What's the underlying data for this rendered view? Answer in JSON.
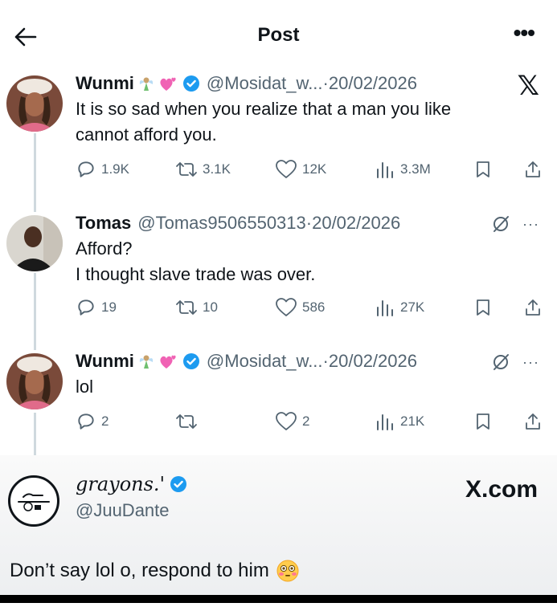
{
  "topbar": {
    "title": "Post"
  },
  "tweets": [
    {
      "name": "Wunmi",
      "emojis": [
        "fairy",
        "two-hearts"
      ],
      "verified": true,
      "handle": "@Mosidat_w...",
      "separator": "·",
      "date": "20/02/2026",
      "text_lines": [
        "It is so sad when you realize that a man you like",
        "cannot afford you."
      ],
      "replies": "1.9K",
      "reposts": "3.1K",
      "likes": "12K",
      "views": "3.3M"
    },
    {
      "name": "Tomas",
      "verified": false,
      "handle": "@Tomas9506550313",
      "separator": "·",
      "date": "20/02/2026",
      "text_lines": [
        "Afford?",
        "I thought slave trade was over."
      ],
      "replies": "19",
      "reposts": "10",
      "likes": "586",
      "views": "27K"
    },
    {
      "name": "Wunmi",
      "emojis": [
        "fairy",
        "two-hearts"
      ],
      "verified": true,
      "handle": "@Mosidat_w...",
      "separator": "·",
      "date": "20/02/2026",
      "text_lines": [
        "lol"
      ],
      "replies": "2",
      "reposts": "",
      "likes": "2",
      "views": "21K"
    }
  ],
  "icons": {
    "back": "arrow-left-icon",
    "more": "more-horizontal-icon",
    "x_logo": "x-logo-icon",
    "reply": "reply-icon",
    "repost": "repost-icon",
    "like": "heart-icon",
    "views": "views-icon",
    "bookmark": "bookmark-icon",
    "share": "share-icon",
    "grok": "grok-icon"
  },
  "footer": {
    "name": "grayons.'",
    "verified": true,
    "handle": "@JuuDante",
    "site": "X.com",
    "caption": "Don’t say lol o, respond to him",
    "caption_emoji": "flushed-face"
  },
  "colors": {
    "text": "#0f1419",
    "secondary": "#536471",
    "verified": "#1d9bf0",
    "thread_line": "#cfd9de"
  }
}
